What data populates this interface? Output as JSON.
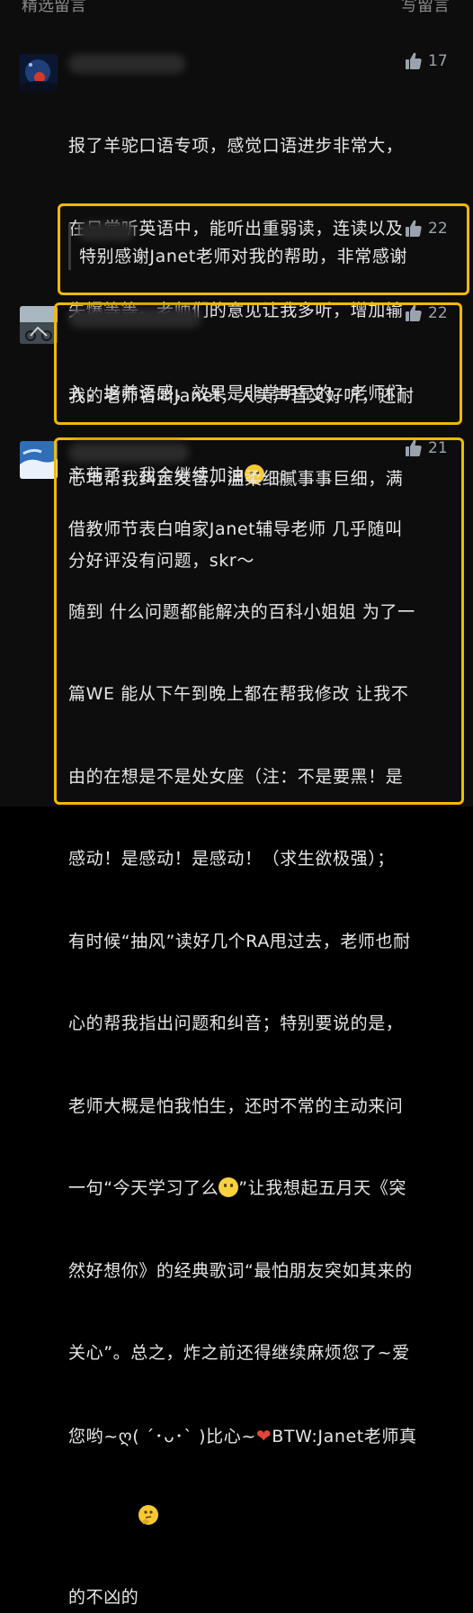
{
  "header": {
    "left_label": "精选留言",
    "right_label": "写留言"
  },
  "comments": [
    {
      "likes": "17",
      "text_line1": "报了羊驼口语专项，感觉口语进步非常大，",
      "text_line2": "在日常听英语中，能听出重弱读，连读以及",
      "text_line3": "失爆等等。老师们的意见让我多听，增加输",
      "text_line4": "入，培养语感，效果是非常明显的。老师们",
      "text_line5_a": "辛苦了，我会继续加油",
      "text_line5_b": " ▯▯▯。",
      "reply": {
        "likes": "22",
        "text": "特别感谢Janet老师对我的帮助，非常感谢"
      }
    },
    {
      "likes": "22",
      "text_line1": "我的老师名叫Janet，人美声音又好听，还耐",
      "text_line2": "心地帮我纠正发音，温柔细腻事事巨细，满",
      "text_line3": "分好评没有问题，skr～"
    },
    {
      "likes": "21",
      "lines": [
        "借教师节表白咱家Janet辅导老师 几乎随叫",
        "随到 什么问题都能解决的百科小姐姐 为了一",
        "篇WE 能从下午到晚上都在帮我修改 让我不",
        "由的在想是不是处女座（注：不是要黑！是",
        "感动！是感动！是感动！（求生欲极强）；",
        "有时候“抽风”读好几个RA甩过去，老师也耐",
        "心的帮我指出问题和纠音；特别要说的是，",
        "老师大概是怕我怕生，还时不常的主动来问"
      ],
      "line9_a": "一句“今天学习了么",
      "line9_b": "”让我想起五月天《突",
      "line10": "然好想你》的经典歌词“最怕朋友突如其来的",
      "line11": "关心”。总之，炸之前还得继续麻烦您了~爱",
      "line12_a": "您哟~ღ( ´･ᴗ･` )比心~",
      "line12_b": "BTW:Janet老师真",
      "line13": "的不凶的"
    }
  ],
  "colors": {
    "highlight": "#f5b800",
    "background": "#0d0d0d",
    "text": "#e6e6e6",
    "meta": "#9aa3ad"
  },
  "icons": [
    "thumbs-up-icon",
    "smile-emoji-icon",
    "heart-emoji-icon",
    "thinking-emoji-icon"
  ]
}
